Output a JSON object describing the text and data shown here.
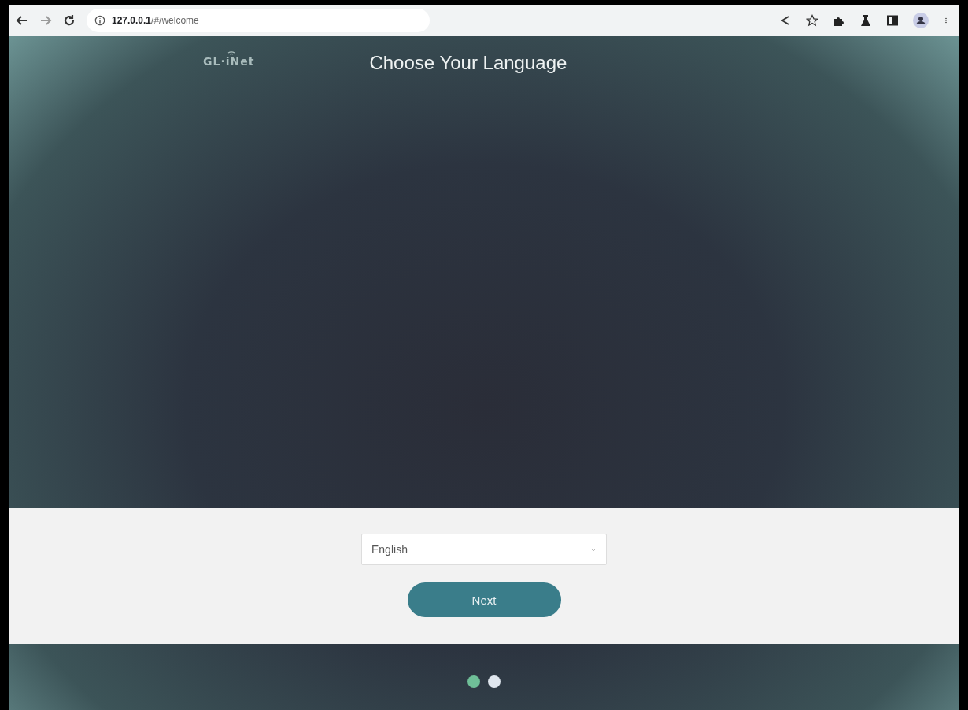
{
  "browser": {
    "url": "**127.0.0.1**/#/welcome"
  },
  "header": {
    "logo": "GL·iNet",
    "title": "Choose Your Language"
  },
  "language_select": {
    "value": "English"
  },
  "buttons": [
    "Next"
  ],
  "pager": [
    {
      "selected": true
    },
    {
      "selected": false
    }
  ]
}
